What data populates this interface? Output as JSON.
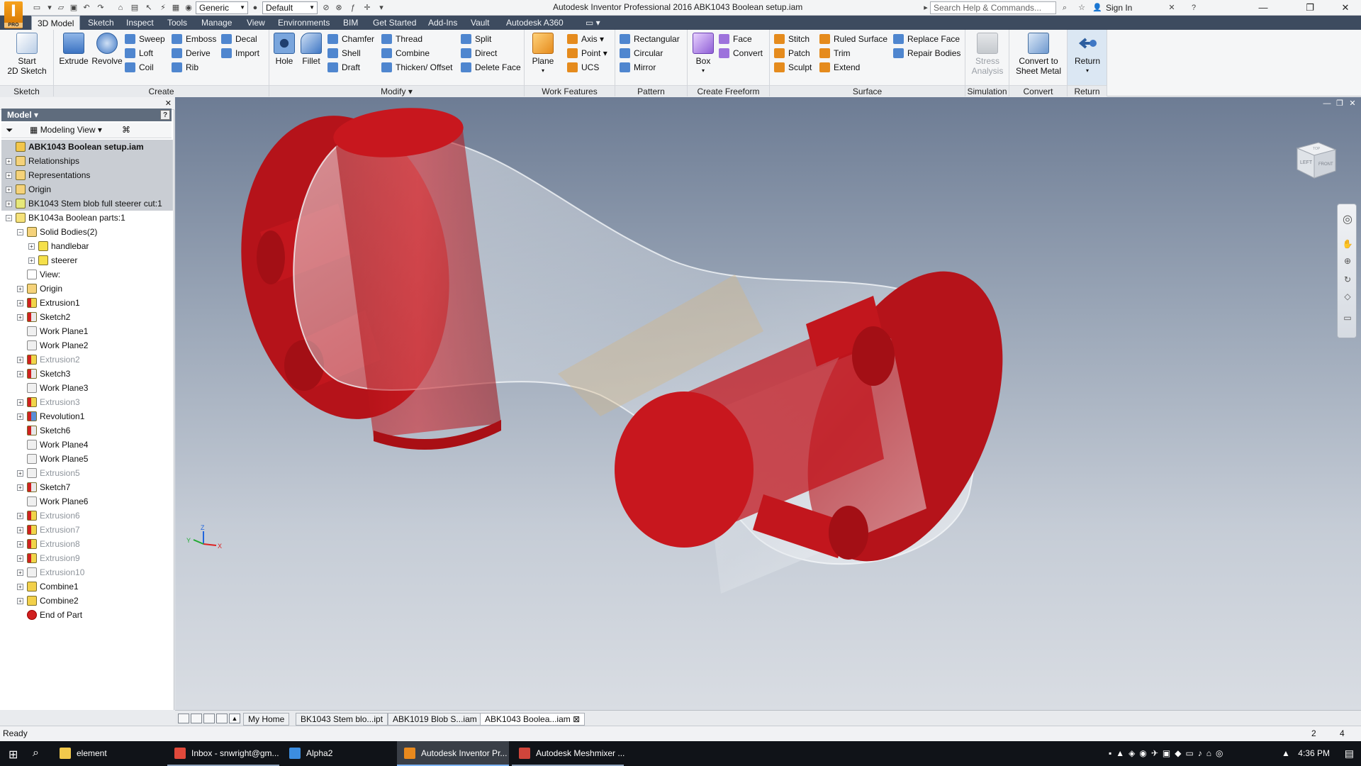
{
  "app": {
    "logo_letter": "I",
    "logo_sub": "PRO",
    "title": "Autodesk Inventor Professional 2016   ABK1043 Boolean setup.iam"
  },
  "quick_access": {
    "material_select": "Generic",
    "appearance_select": "Default",
    "search_placeholder": "Search Help & Commands...",
    "sign_in": "Sign In"
  },
  "tabs": [
    "3D Model",
    "Sketch",
    "Inspect",
    "Tools",
    "Manage",
    "View",
    "Environments",
    "BIM",
    "Get Started",
    "Add-Ins",
    "Vault",
    "Autodesk A360"
  ],
  "ribbon": {
    "sketch": {
      "title": "Sketch",
      "start": "Start",
      "start2": "2D Sketch"
    },
    "create": {
      "title": "Create",
      "extrude": "Extrude",
      "revolve": "Revolve",
      "sweep": "Sweep",
      "loft": "Loft",
      "coil": "Coil",
      "emboss": "Emboss",
      "derive": "Derive",
      "rib": "Rib",
      "decal": "Decal",
      "import": "Import"
    },
    "modify": {
      "title": "Modify ▾",
      "hole": "Hole",
      "fillet": "Fillet",
      "chamfer": "Chamfer",
      "shell": "Shell",
      "draft": "Draft",
      "thread": "Thread",
      "combine": "Combine",
      "thicken": "Thicken/ Offset",
      "split": "Split",
      "direct": "Direct",
      "delete_face": "Delete Face"
    },
    "work_features": {
      "title": "Work Features",
      "plane": "Plane",
      "axis": "Axis",
      "point": "Point",
      "ucs": "UCS"
    },
    "pattern": {
      "title": "Pattern",
      "rectangular": "Rectangular",
      "circular": "Circular",
      "mirror": "Mirror"
    },
    "freeform": {
      "title": "Create Freeform",
      "box": "Box",
      "face": "Face",
      "convert": "Convert"
    },
    "surface": {
      "title": "Surface",
      "stitch": "Stitch",
      "patch": "Patch",
      "sculpt": "Sculpt",
      "ruled_surface": "Ruled Surface",
      "trim": "Trim",
      "extend": "Extend",
      "replace_face": "Replace Face",
      "repair_bodies": "Repair Bodies"
    },
    "simulation": {
      "title": "Simulation",
      "stress": "Stress",
      "analysis": "Analysis"
    },
    "convert": {
      "title": "Convert",
      "line1": "Convert to",
      "line2": "Sheet Metal"
    },
    "return": {
      "title": "Return",
      "label": "Return"
    }
  },
  "browser": {
    "tab_label": "Model ▾",
    "help": "?",
    "view_mode": "Modeling View",
    "tree": [
      {
        "label": "ABK1043 Boolean setup.iam",
        "depth": 0,
        "icon": "assembly",
        "style": "root",
        "exp": ""
      },
      {
        "label": "Relationships",
        "depth": 0,
        "icon": "folder",
        "style": "hl",
        "exp": "+"
      },
      {
        "label": "Representations",
        "depth": 0,
        "icon": "folder",
        "style": "hl",
        "exp": "+"
      },
      {
        "label": "Origin",
        "depth": 0,
        "icon": "folder",
        "style": "hl",
        "exp": "+"
      },
      {
        "label": "BK1043 Stem blob full steerer cut:1",
        "depth": 0,
        "icon": "part-check",
        "style": "hl",
        "exp": "+"
      },
      {
        "label": "BK1043a Boolean parts:1",
        "depth": 0,
        "icon": "part",
        "style": "",
        "exp": "−"
      },
      {
        "label": "Solid Bodies(2)",
        "depth": 1,
        "icon": "folder-bodies",
        "style": "",
        "exp": "−"
      },
      {
        "label": "handlebar",
        "depth": 2,
        "icon": "body",
        "style": "",
        "exp": "+"
      },
      {
        "label": "steerer",
        "depth": 2,
        "icon": "body",
        "style": "",
        "exp": "+"
      },
      {
        "label": "View:",
        "depth": 1,
        "icon": "view",
        "style": "",
        "exp": ""
      },
      {
        "label": "Origin",
        "depth": 1,
        "icon": "folder",
        "style": "",
        "exp": "+"
      },
      {
        "label": "Extrusion1",
        "depth": 1,
        "icon": "extrusion",
        "style": "",
        "exp": "+"
      },
      {
        "label": "Sketch2",
        "depth": 1,
        "icon": "sketch",
        "style": "",
        "exp": "+"
      },
      {
        "label": "Work Plane1",
        "depth": 1,
        "icon": "plane",
        "style": "",
        "exp": ""
      },
      {
        "label": "Work Plane2",
        "depth": 1,
        "icon": "plane",
        "style": "",
        "exp": ""
      },
      {
        "label": "Extrusion2",
        "depth": 1,
        "icon": "extrusion",
        "style": "dim",
        "exp": "+"
      },
      {
        "label": "Sketch3",
        "depth": 1,
        "icon": "sketch",
        "style": "",
        "exp": "+"
      },
      {
        "label": "Work Plane3",
        "depth": 1,
        "icon": "plane",
        "style": "",
        "exp": ""
      },
      {
        "label": "Extrusion3",
        "depth": 1,
        "icon": "extrusion",
        "style": "dim",
        "exp": "+"
      },
      {
        "label": "Revolution1",
        "depth": 1,
        "icon": "revolve",
        "style": "",
        "exp": "+"
      },
      {
        "label": "Sketch6",
        "depth": 1,
        "icon": "sketch",
        "style": "",
        "exp": ""
      },
      {
        "label": "Work Plane4",
        "depth": 1,
        "icon": "plane",
        "style": "",
        "exp": ""
      },
      {
        "label": "Work Plane5",
        "depth": 1,
        "icon": "plane",
        "style": "",
        "exp": ""
      },
      {
        "label": "Extrusion5",
        "depth": 1,
        "icon": "plane",
        "style": "dim",
        "exp": "+"
      },
      {
        "label": "Sketch7",
        "depth": 1,
        "icon": "sketch",
        "style": "",
        "exp": "+"
      },
      {
        "label": "Work Plane6",
        "depth": 1,
        "icon": "plane",
        "style": "",
        "exp": ""
      },
      {
        "label": "Extrusion6",
        "depth": 1,
        "icon": "extrusion",
        "style": "dim",
        "exp": "+"
      },
      {
        "label": "Extrusion7",
        "depth": 1,
        "icon": "extrusion",
        "style": "dim",
        "exp": "+"
      },
      {
        "label": "Extrusion8",
        "depth": 1,
        "icon": "extrusion",
        "style": "dim",
        "exp": "+"
      },
      {
        "label": "Extrusion9",
        "depth": 1,
        "icon": "extrusion",
        "style": "dim",
        "exp": "+"
      },
      {
        "label": "Extrusion10",
        "depth": 1,
        "icon": "plane",
        "style": "dim",
        "exp": "+"
      },
      {
        "label": "Combine1",
        "depth": 1,
        "icon": "combine",
        "style": "",
        "exp": "+"
      },
      {
        "label": "Combine2",
        "depth": 1,
        "icon": "combine",
        "style": "",
        "exp": "+"
      },
      {
        "label": "End of Part",
        "depth": 1,
        "icon": "end",
        "style": "",
        "exp": ""
      }
    ]
  },
  "viewcube": {
    "face1": "LEFT",
    "face2": "FRONT",
    "face3": "TOP"
  },
  "triad": {
    "x": "X",
    "y": "Y",
    "z": "Z"
  },
  "doc_tabs": [
    {
      "label": "My Home",
      "active": false
    },
    {
      "label": "BK1043 Stem blo...ipt",
      "active": false
    },
    {
      "label": "ABK1019 Blob S...iam",
      "active": false
    },
    {
      "label": "ABK1043 Boolea...iam",
      "active": true
    }
  ],
  "status": {
    "text": "Ready",
    "count1": "2",
    "count2": "4"
  },
  "taskbar": {
    "items": [
      {
        "label": "element",
        "color": "#f2c94c",
        "state": ""
      },
      {
        "label": "Inbox - snwright@gm...",
        "color": "#e0493b",
        "state": "open"
      },
      {
        "label": "Alpha2",
        "color": "#3c8de0",
        "state": ""
      },
      {
        "label": "Autodesk Inventor Pr...",
        "color": "#e8891d",
        "state": "active"
      },
      {
        "label": "Autodesk Meshmixer ...",
        "color": "#d0453b",
        "state": "open"
      }
    ],
    "time": "4:36 PM"
  },
  "colors": {
    "solid_red": "#c0141b",
    "ghost_body": "#e9edf2",
    "tab_bar": "#3d4b5f"
  }
}
